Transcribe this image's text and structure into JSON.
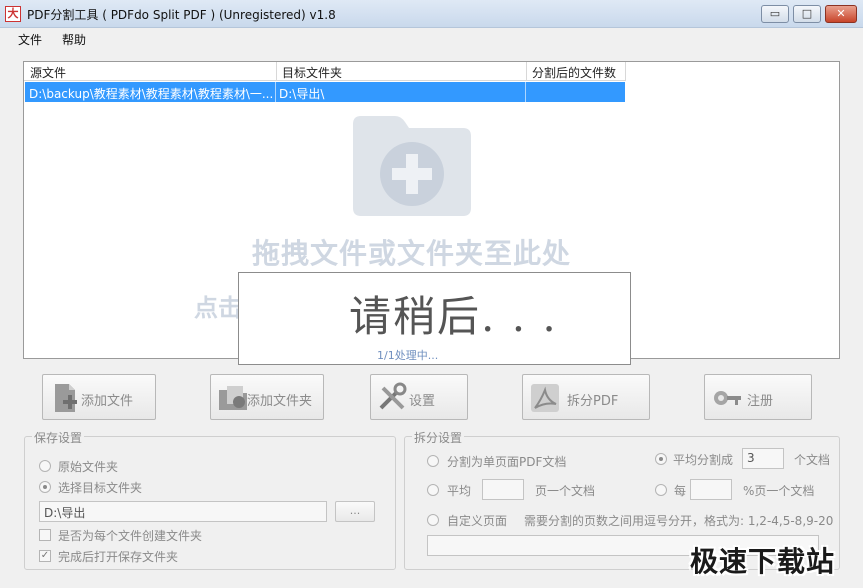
{
  "window": {
    "title": "PDF分割工具 ( PDFdo Split PDF ) (Unregistered) v1.8",
    "app_icon_glyph": "大",
    "minimize_glyph": "▭",
    "maximize_glyph": "□",
    "close_glyph": "✕"
  },
  "menu": {
    "file": "文件",
    "help": "帮助"
  },
  "list": {
    "columns": [
      "源文件",
      "目标文件夹",
      "分割后的文件数"
    ],
    "rows": [
      {
        "source": "D:\\backup\\教程素材\\教程素材\\教程素材\\一...",
        "target": "D:\\导出\\",
        "count": ""
      }
    ],
    "drop_hint": "拖拽文件或文件夹至此处",
    "drop_hint_partial": "点击"
  },
  "progress": {
    "title": "请稍后. . .",
    "status": "1/1处理中..."
  },
  "toolbar": {
    "add_file": "添加文件",
    "add_folder": "添加文件夹",
    "settings": "设置",
    "split_pdf": "拆分PDF",
    "register": "注册"
  },
  "save_settings": {
    "title": "保存设置",
    "original_folder": "原始文件夹",
    "choose_target": "选择目标文件夹",
    "path": "D:\\导出",
    "browse": "...",
    "create_folder_each": "是否为每个文件创建文件夹",
    "open_when_done": "完成后打开保存文件夹",
    "check_glyph": "✓"
  },
  "split_settings": {
    "title": "拆分设置",
    "single_page": "分割为单页面PDF文档",
    "even_split": "平均分割成",
    "even_split_count": "3",
    "docs_suffix": "个文档",
    "average": "平均",
    "pages_per_doc": "页一个文档",
    "each": "每",
    "percent_per_doc": "%页一个文档",
    "custom_pages": "自定义页面",
    "custom_hint": "需要分割的页数之间用逗号分开，格式为: 1,2-4,5-8,9-20"
  },
  "watermark": "极速下载站",
  "colors": {
    "selection": "#3399ff",
    "disabled_text": "#8a8a8a",
    "hint": "#cfd7e2"
  }
}
